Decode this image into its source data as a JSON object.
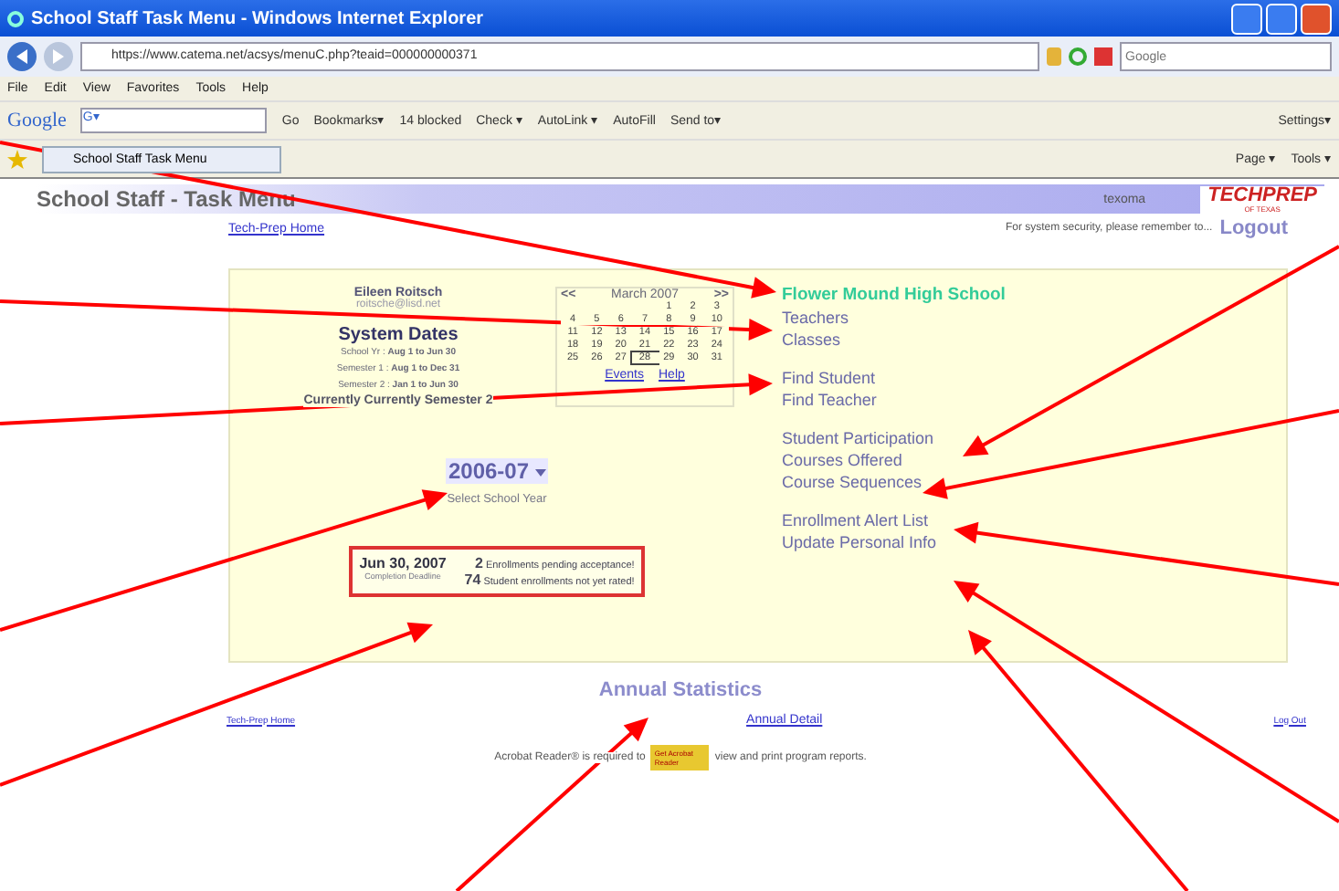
{
  "window": {
    "title": "School Staff Task Menu - Windows Internet Explorer"
  },
  "address_bar": {
    "url": "https://www.catema.net/acsys/menuC.php?teaid=000000000371",
    "search_placeholder": "Google"
  },
  "menu_bar": [
    "File",
    "Edit",
    "View",
    "Favorites",
    "Tools",
    "Help"
  ],
  "google_toolbar": {
    "logo": "Google",
    "field": "G▾",
    "items": [
      "Go",
      "Bookmarks▾",
      "14 blocked",
      "Check ▾",
      "AutoLink ▾",
      "AutoFill",
      "Send to▾"
    ],
    "settings": "Settings▾"
  },
  "tab_bar": {
    "tab": "School Staff Task Menu",
    "commands": [
      "Page ▾",
      "Tools ▾"
    ]
  },
  "page": {
    "header": {
      "title": "School Staff - Task Menu",
      "region": "texoma",
      "logo": "TECHPREP",
      "logo_sub": "OF TEXAS"
    },
    "top_links": {
      "home": "Tech-Prep Home",
      "notice": "For system security, please remember to...",
      "logout": "Logout"
    },
    "user": {
      "name": "Eileen Roitsch",
      "email": "roitsche@lisd.net"
    },
    "system_dates": {
      "title": "System Dates",
      "rows": [
        {
          "label": "School Yr :",
          "range": "Aug 1 to Jun 30"
        },
        {
          "label": "Semester 1 :",
          "range": "Aug 1 to Dec 31"
        },
        {
          "label": "Semester 2 :",
          "range": "Jan 1 to Jun 30"
        }
      ],
      "current": "Currently Currently Semester 2"
    },
    "calendar": {
      "prev": "<<",
      "month": "March 2007",
      "next": ">>",
      "weeks": [
        [
          {
            "day": "1",
            "today": false
          },
          {
            "day": "2",
            "today": false
          },
          {
            "day": "3",
            "today": false
          }
        ],
        [
          {
            "day": "4",
            "today": false
          },
          {
            "day": "5",
            "today": false
          },
          {
            "day": "6",
            "today": false
          },
          {
            "day": "7",
            "today": false
          },
          {
            "day": "8",
            "today": false
          },
          {
            "day": "9",
            "today": false
          },
          {
            "day": "10",
            "today": false
          }
        ],
        [
          {
            "day": "11",
            "today": false
          },
          {
            "day": "12",
            "today": false
          },
          {
            "day": "13",
            "today": false
          },
          {
            "day": "14",
            "today": false
          },
          {
            "day": "15",
            "today": false
          },
          {
            "day": "16",
            "today": false
          },
          {
            "day": "17",
            "today": false
          }
        ],
        [
          {
            "day": "18",
            "today": false
          },
          {
            "day": "19",
            "today": false
          },
          {
            "day": "20",
            "today": false
          },
          {
            "day": "21",
            "today": false
          },
          {
            "day": "22",
            "today": false
          },
          {
            "day": "23",
            "today": false
          },
          {
            "day": "24",
            "today": false
          }
        ],
        [
          {
            "day": "25",
            "today": false
          },
          {
            "day": "26",
            "today": false
          },
          {
            "day": "27",
            "today": false
          },
          {
            "day": "28",
            "today": true
          },
          {
            "day": "29",
            "today": false
          },
          {
            "day": "30",
            "today": false
          },
          {
            "day": "31",
            "today": false
          }
        ]
      ],
      "links": [
        "Events",
        "Help"
      ]
    },
    "school_year": {
      "value": "2006-07",
      "caption": "Select School Year"
    },
    "deadline": {
      "date": "Jun 30, 2007",
      "caption": "Completion Deadline",
      "alerts": [
        {
          "count": "2",
          "text": "Enrollments pending acceptance!"
        },
        {
          "count": "74",
          "text": "Student enrollments not yet rated!"
        }
      ]
    },
    "menu_groups": [
      [
        {
          "label": "Flower Mound High School",
          "kind": "heading"
        },
        {
          "label": "Teachers",
          "kind": "link"
        },
        {
          "label": "Classes",
          "kind": "link"
        }
      ],
      [
        {
          "label": "Find Student",
          "kind": "link"
        },
        {
          "label": "Find Teacher",
          "kind": "link"
        }
      ],
      [
        {
          "label": "Student Participation",
          "kind": "link"
        },
        {
          "label": "Courses Offered",
          "kind": "link"
        },
        {
          "label": "Course Sequences",
          "kind": "link"
        }
      ],
      [
        {
          "label": "Enrollment Alert List",
          "kind": "link"
        },
        {
          "label": "Update Personal Info",
          "kind": "link"
        }
      ]
    ],
    "annual_statistics": {
      "title": "Annual Statistics",
      "left_link": "Tech-Prep Home",
      "center_link": "Annual Detail",
      "right_link": "Log Out"
    },
    "acrobat_note": {
      "before": "Acrobat Reader® is required to",
      "badge": "Get Acrobat Reader",
      "after": "view and print program reports."
    }
  }
}
